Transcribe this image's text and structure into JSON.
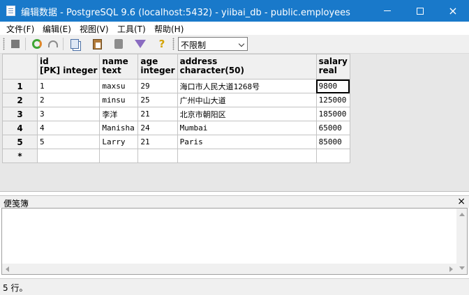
{
  "window": {
    "title": "编辑数据 - PostgreSQL 9.6 (localhost:5432) - yiibai_db - public.employees",
    "minimize": "minimize",
    "maximize": "maximize",
    "close": "×"
  },
  "menu": [
    "文件(F)",
    "编辑(E)",
    "视图(V)",
    "工具(T)",
    "帮助(H)"
  ],
  "toolbar": {
    "icons": [
      "stop-icon",
      "refresh-icon",
      "undo-icon",
      "copy-icon",
      "paste-icon",
      "delete-icon",
      "filter-icon",
      "help-icon"
    ],
    "limit_select": "不限制"
  },
  "grid": {
    "columns": [
      {
        "name": "id",
        "type": "[PK] integer"
      },
      {
        "name": "name",
        "type": "text"
      },
      {
        "name": "age",
        "type": "integer"
      },
      {
        "name": "address",
        "type": "character(50)"
      },
      {
        "name": "salary",
        "type": "real"
      }
    ],
    "rows": [
      {
        "num": "1",
        "cells": [
          "1",
          "maxsu",
          "29",
          "海口市人民大道1268号",
          "9800"
        ]
      },
      {
        "num": "2",
        "cells": [
          "2",
          "minsu",
          "25",
          "广州中山大道",
          "125000"
        ]
      },
      {
        "num": "3",
        "cells": [
          "3",
          "李洋",
          "21",
          "北京市朝阳区",
          "185000"
        ]
      },
      {
        "num": "4",
        "cells": [
          "4",
          "Manisha",
          "24",
          "Mumbai",
          "65000"
        ]
      },
      {
        "num": "5",
        "cells": [
          "5",
          "Larry",
          "21",
          "Paris",
          "85000"
        ]
      }
    ],
    "new_row_marker": "*"
  },
  "notes": {
    "title": "便笺簿",
    "close": "×"
  },
  "status": {
    "text": "5 行。"
  }
}
